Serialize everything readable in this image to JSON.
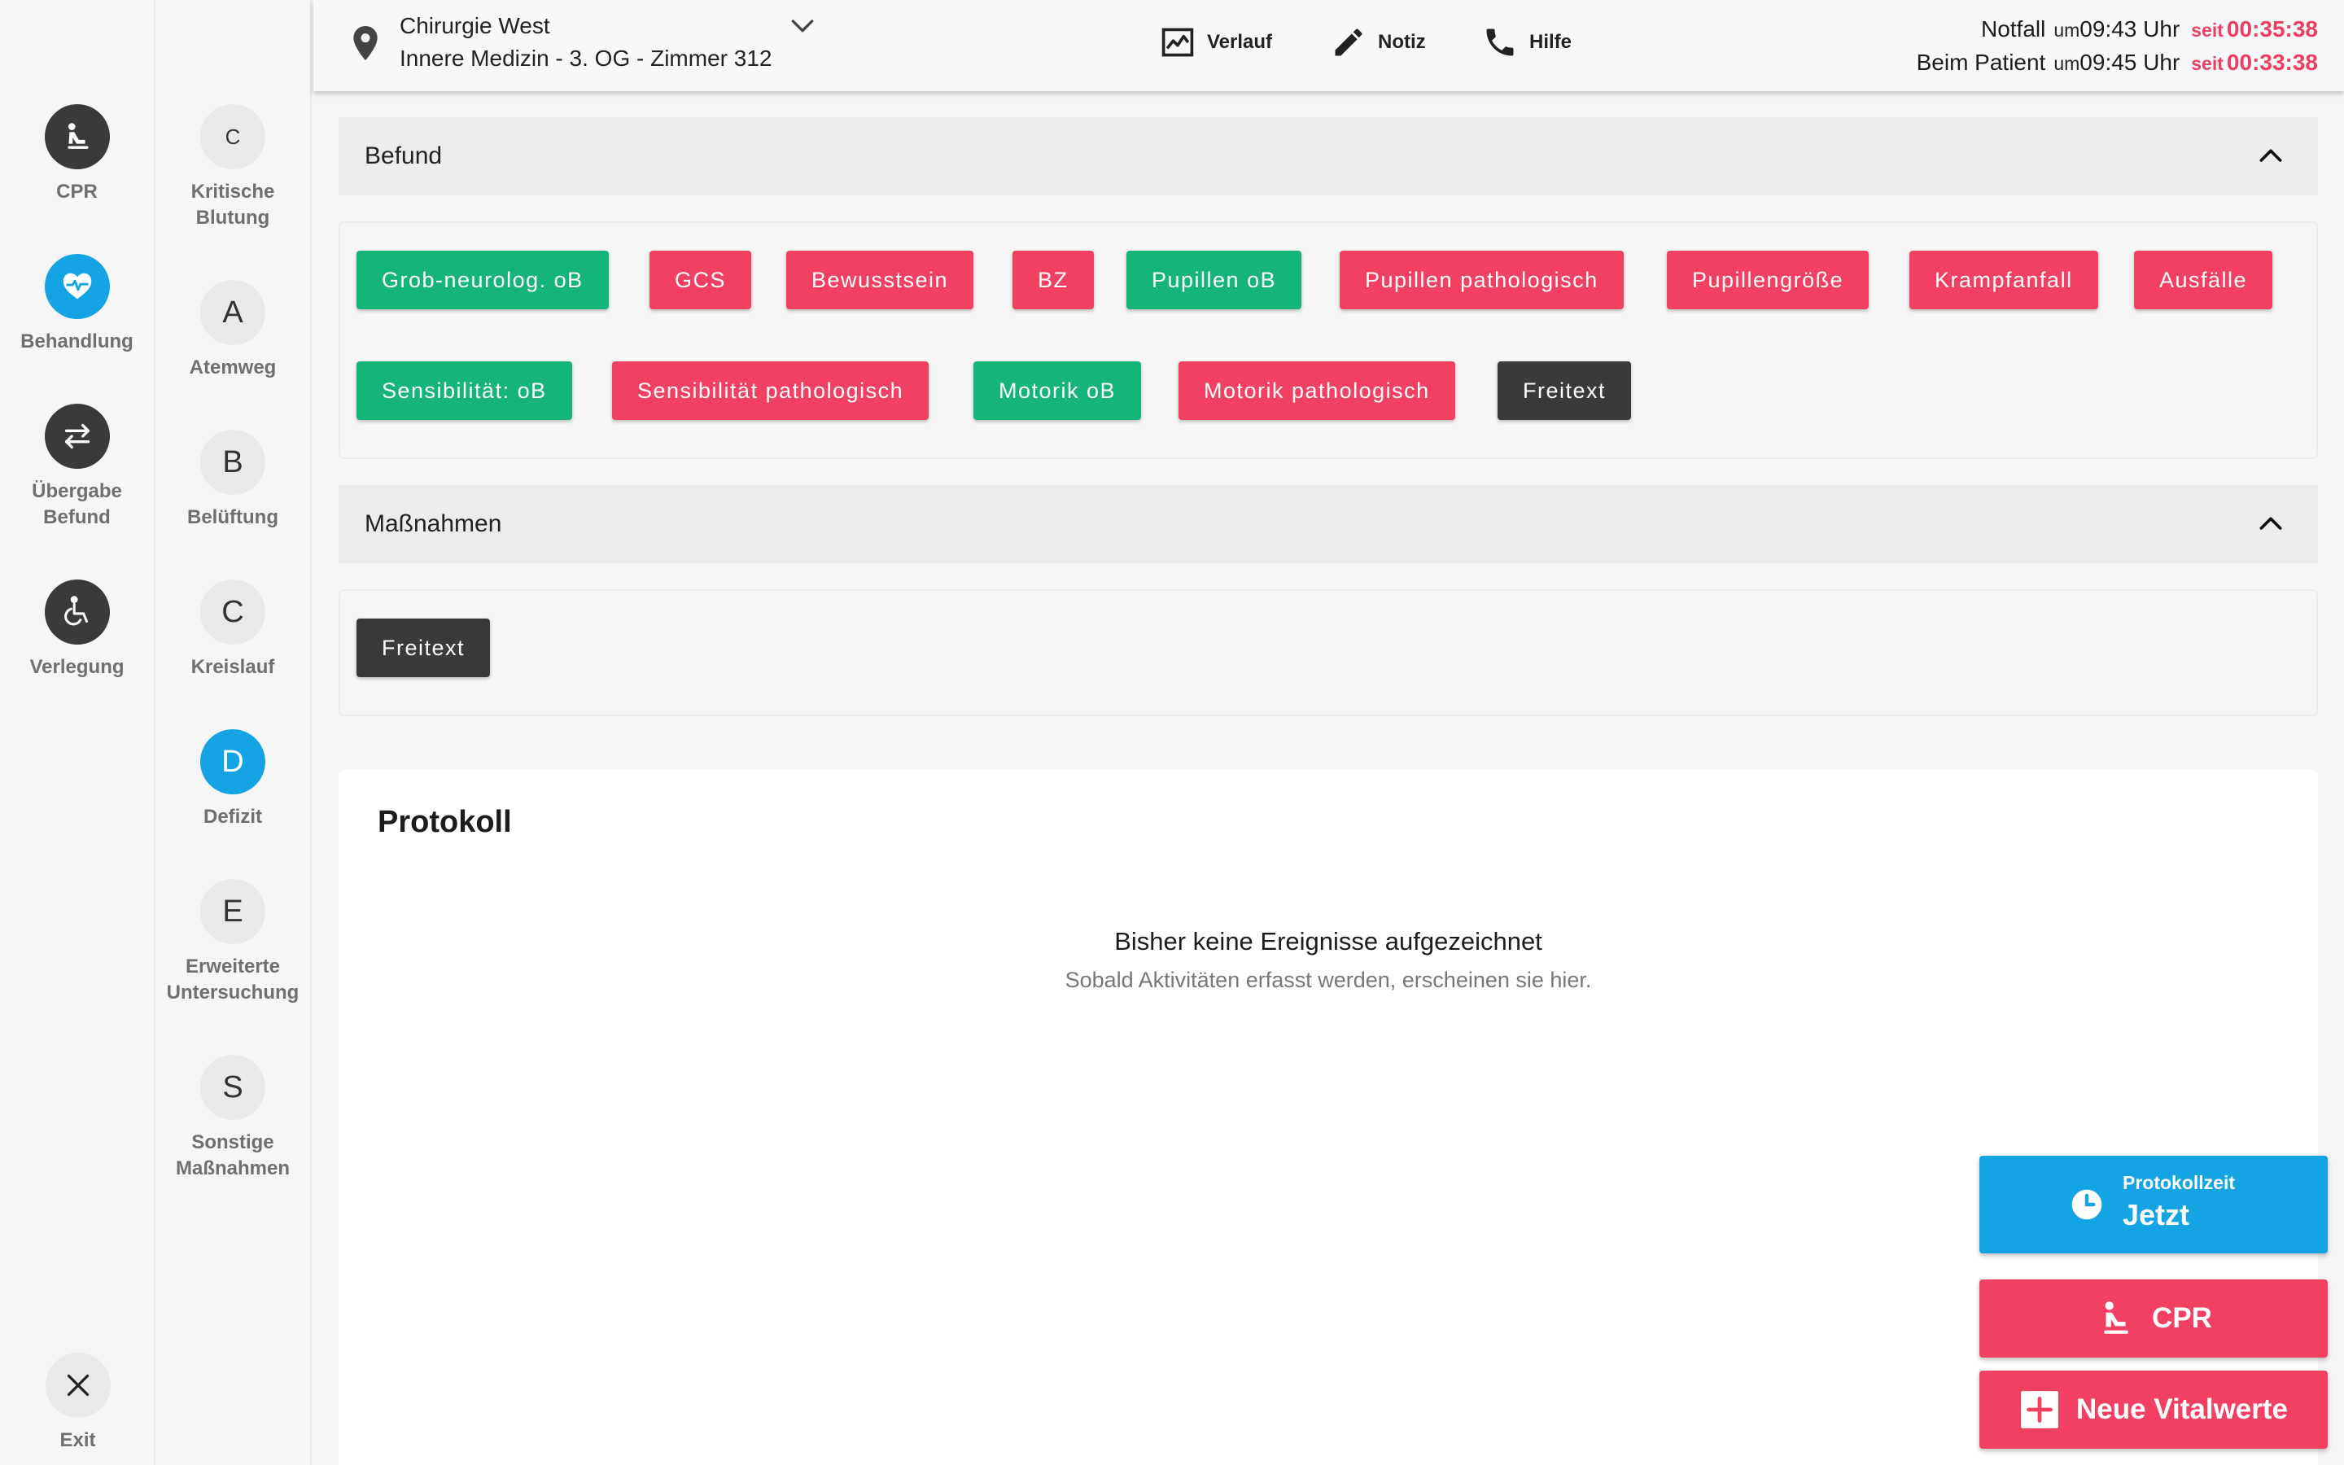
{
  "rail_primary": [
    {
      "label": "CPR",
      "icon": "cpr-icon",
      "style": "dark"
    },
    {
      "label": "Behandlung",
      "icon": "heart-pulse-icon",
      "style": "blue"
    },
    {
      "label": "Übergabe\nBefund",
      "icon": "swap-arrows-icon",
      "style": "dark"
    },
    {
      "label": "Verlegung",
      "icon": "wheelchair-icon",
      "style": "dark"
    }
  ],
  "exit_label": "Exit",
  "rail_secondary": [
    {
      "letter": "C",
      "label": "Kritische\nBlutung"
    },
    {
      "letter": "A",
      "label": "Atemweg"
    },
    {
      "letter": "B",
      "label": "Belüftung"
    },
    {
      "letter": "C",
      "label": "Kreislauf"
    },
    {
      "letter": "D",
      "label": "Defizit",
      "active": true
    },
    {
      "letter": "E",
      "label": "Erweiterte\nUntersuchung"
    },
    {
      "letter": "S",
      "label": "Sonstige\nMaßnahmen"
    }
  ],
  "header": {
    "location_line1": "Chirurgie West",
    "location_line2": "Innere Medizin - 3. OG - Zimmer 312",
    "tools": {
      "verlauf": "Verlauf",
      "notiz": "Notiz",
      "hilfe": "Hilfe"
    },
    "notfall": {
      "label": "Notfall",
      "um": "um",
      "time": "09:43 Uhr",
      "seit": "seit",
      "duration": "00:35:38"
    },
    "patient": {
      "label": "Beim Patient",
      "um": "um",
      "time": "09:45 Uhr",
      "seit": "seit",
      "duration": "00:33:38"
    }
  },
  "befund": {
    "title": "Befund",
    "chips": [
      {
        "label": "Grob-neurolog. oB",
        "color": "green"
      },
      {
        "label": "GCS",
        "color": "red"
      },
      {
        "label": "Bewusstsein",
        "color": "red"
      },
      {
        "label": "BZ",
        "color": "red"
      },
      {
        "label": "Pupillen oB",
        "color": "green"
      },
      {
        "label": "Pupillen pathologisch",
        "color": "red"
      },
      {
        "label": "Pupillengröße",
        "color": "red"
      },
      {
        "label": "Krampfanfall",
        "color": "red"
      },
      {
        "label": "Ausfälle",
        "color": "red"
      },
      {
        "label": "Sensibilität: oB",
        "color": "green"
      },
      {
        "label": "Sensibilität pathologisch",
        "color": "red"
      },
      {
        "label": "Motorik oB",
        "color": "green"
      },
      {
        "label": "Motorik pathologisch",
        "color": "red"
      },
      {
        "label": "Freitext",
        "color": "dark"
      }
    ]
  },
  "massnahmen": {
    "title": "Maßnahmen",
    "chips": [
      {
        "label": "Freitext",
        "color": "dark"
      }
    ]
  },
  "protokoll": {
    "title": "Protokoll",
    "empty_title": "Bisher keine Ereignisse aufgezeichnet",
    "empty_sub": "Sobald Aktivitäten erfasst werden, erscheinen sie hier."
  },
  "actions": {
    "time_label": "Protokollzeit",
    "time_value": "Jetzt",
    "cpr": "CPR",
    "vitals": "Neue Vitalwerte"
  },
  "colors": {
    "accent_blue": "#14a3e3",
    "green": "#15b57a",
    "red": "#f24062",
    "dark": "#3a3a3a",
    "duration_red": "#e84060"
  }
}
